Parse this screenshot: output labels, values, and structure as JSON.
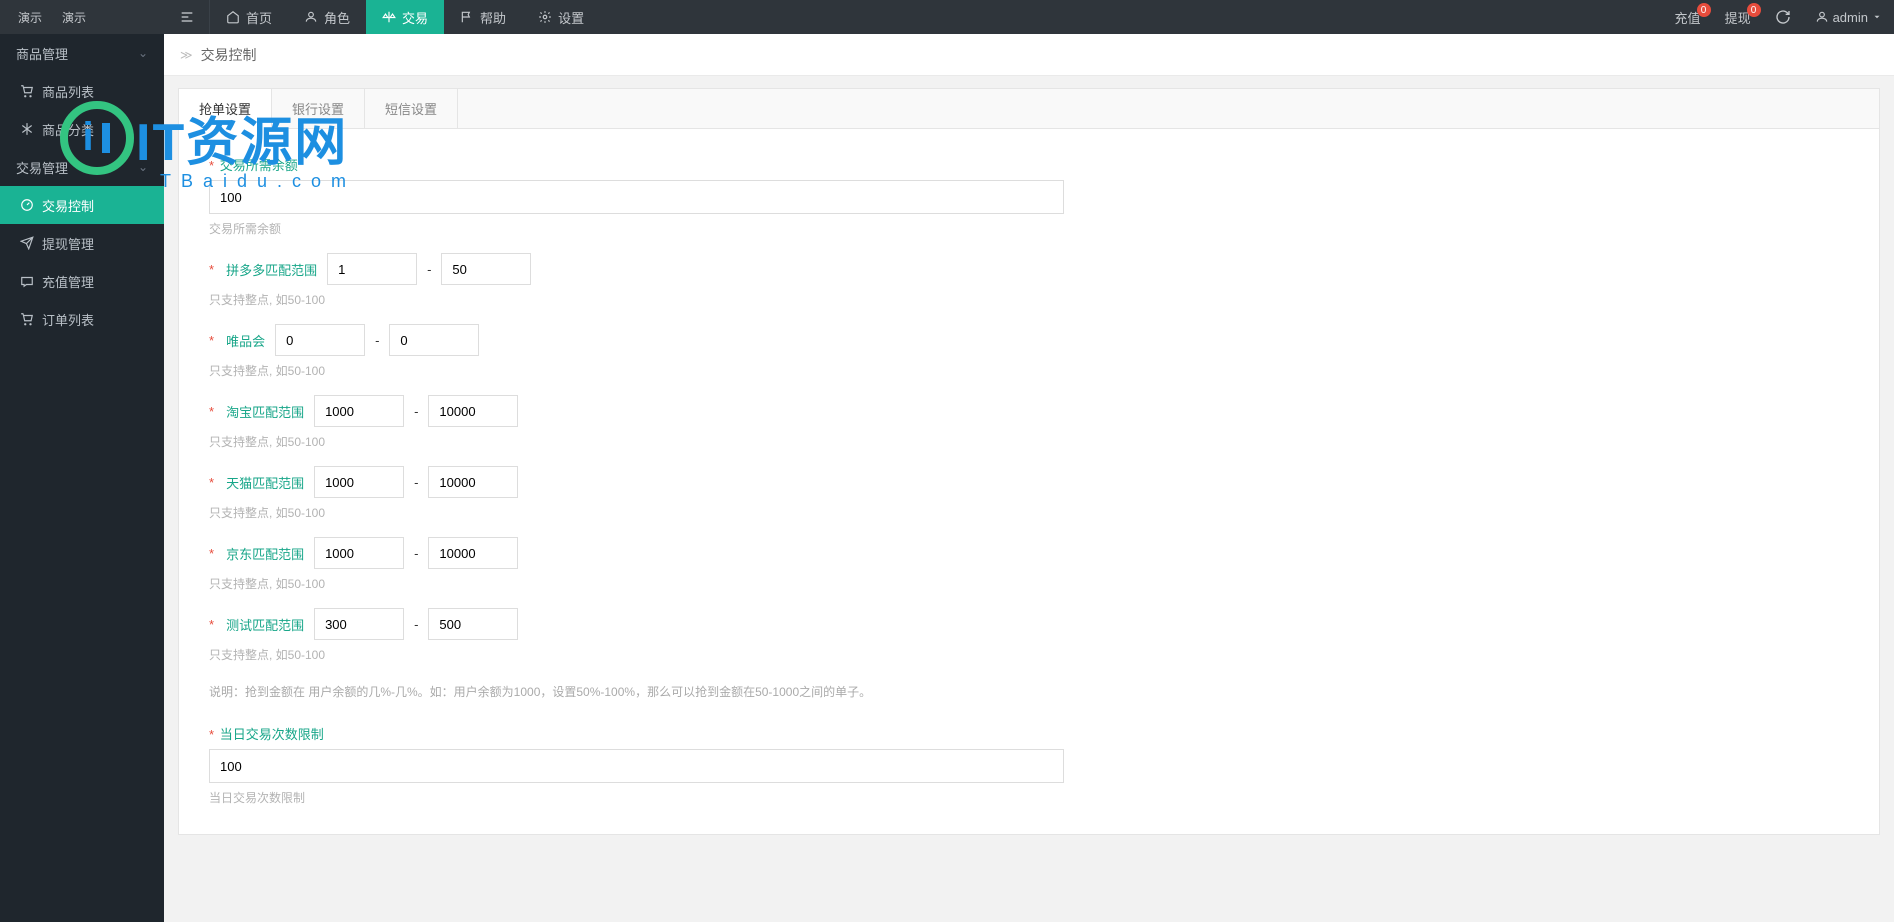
{
  "logo": {
    "left": "演示",
    "right": "演示"
  },
  "topnav": {
    "home": "首页",
    "role": "角色",
    "trade": "交易",
    "help": "帮助",
    "settings": "设置"
  },
  "topright": {
    "recharge": "充值",
    "withdraw": "提现",
    "recharge_badge": "0",
    "withdraw_badge": "0",
    "user": "admin"
  },
  "sidebar": {
    "group_product": "商品管理",
    "product_list": "商品列表",
    "product_category": "商品分类",
    "group_trade": "交易管理",
    "trade_control": "交易控制",
    "withdraw_mgmt": "提现管理",
    "recharge_mgmt": "充值管理",
    "order_list": "订单列表"
  },
  "breadcrumb": {
    "title": "交易控制"
  },
  "tabs": {
    "grab": "抢单设置",
    "bank": "银行设置",
    "sms": "短信设置"
  },
  "form": {
    "balance": {
      "label": "交易所需余额",
      "value": "100",
      "help": "交易所需余额"
    },
    "pdd": {
      "label": "拼多多匹配范围",
      "min": "1",
      "max": "50",
      "help": "只支持整点, 如50-100"
    },
    "wph": {
      "label": "唯品会",
      "min": "0",
      "max": "0",
      "help": "只支持整点, 如50-100"
    },
    "taobao": {
      "label": "淘宝匹配范围",
      "min": "1000",
      "max": "10000",
      "help": "只支持整点, 如50-100"
    },
    "tmall": {
      "label": "天猫匹配范围",
      "min": "1000",
      "max": "10000",
      "help": "只支持整点, 如50-100"
    },
    "jd": {
      "label": "京东匹配范围",
      "min": "1000",
      "max": "10000",
      "help": "只支持整点, 如50-100"
    },
    "test": {
      "label": "测试匹配范围",
      "min": "300",
      "max": "500",
      "help": "只支持整点, 如50-100"
    },
    "desc": "说明：抢到金额在 用户余额的几%-几%。如：用户余额为1000，设置50%-100%，那么可以抢到金额在50-1000之间的单子。",
    "daily_limit": {
      "label": "当日交易次数限制",
      "value": "100",
      "help": "当日交易次数限制"
    }
  },
  "watermark": {
    "main": "IT资源网",
    "sub": "TBaidu.com"
  }
}
